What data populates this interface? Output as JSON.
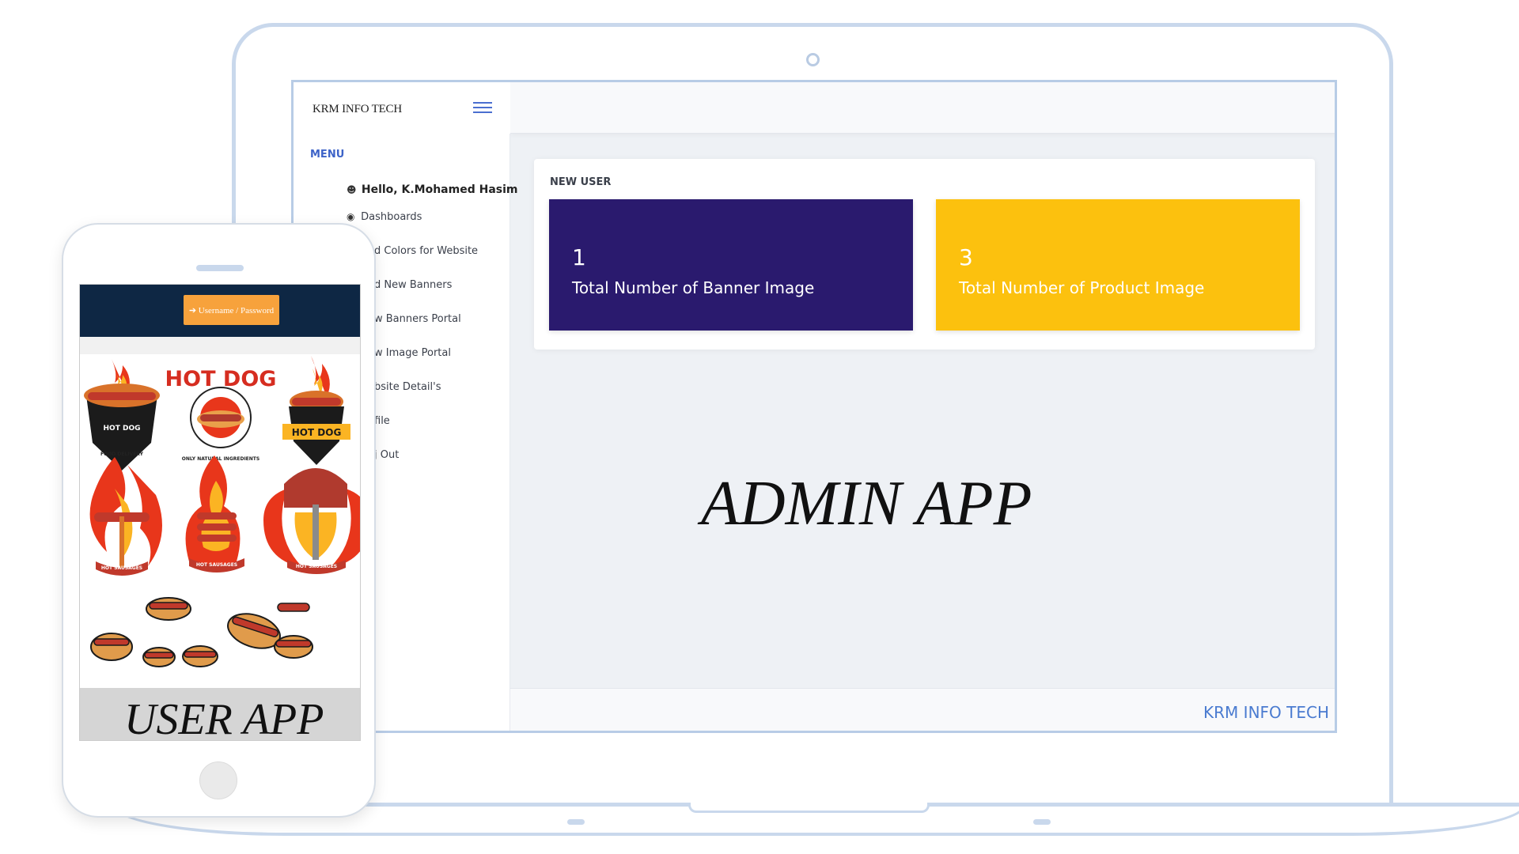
{
  "admin": {
    "brand": "KRM INFO TECH",
    "menu_title": "MENU",
    "menu_items": [
      {
        "icon": "user-icon",
        "label": "Hello, K.Mohamed Hasim"
      },
      {
        "icon": "dashboard-icon",
        "label": "Dashboards"
      },
      {
        "icon": "",
        "label": "d Colors for Website"
      },
      {
        "icon": "",
        "label": "d New Banners"
      },
      {
        "icon": "",
        "label": "w Banners Portal"
      },
      {
        "icon": "",
        "label": "w Image Portal"
      },
      {
        "icon": "",
        "label": "bsite Detail's"
      },
      {
        "icon": "",
        "label": "file"
      },
      {
        "icon": "",
        "label": "j Out"
      }
    ],
    "card_title": "NEW USER",
    "stats": [
      {
        "value": "1",
        "label": "Total Number of Banner Image",
        "color": "#2a1a6e"
      },
      {
        "value": "3",
        "label": "Total Number of Product Image",
        "color": "#fcc10e"
      }
    ],
    "watermark": "ADMIN APP",
    "footer": "KRM INFO TECH"
  },
  "user_app": {
    "login_button": "➔ Username / Password",
    "watermark": "USER APP",
    "art": {
      "badge_hot_dog": "HOT DOG",
      "badge_food_delivery": "FOOD DELIVERY",
      "badge_only_natural": "ONLY NATURAL INGREDIENTS",
      "badge_hot_sausages": "HOT SAUSAGES"
    }
  },
  "colors": {
    "accent_blue": "#3d63c8",
    "stat_purple": "#2a1a6e",
    "stat_yellow": "#fcc10e",
    "user_header": "#0e2744",
    "login_orange": "#f7a23c"
  }
}
